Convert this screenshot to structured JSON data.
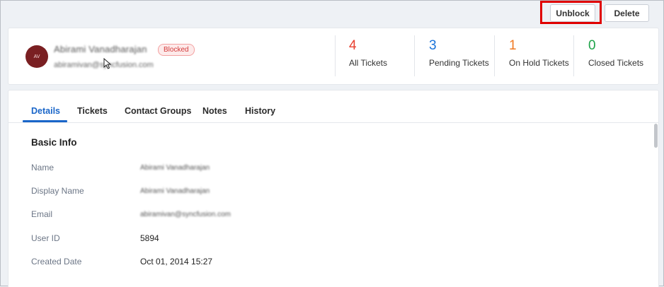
{
  "actions": {
    "unblock_label": "Unblock",
    "delete_label": "Delete"
  },
  "profile": {
    "initials": "AV",
    "name": "Abirami Vanadharajan",
    "email": "abiramivan@syncfusion.com",
    "status_badge": "Blocked"
  },
  "stats": [
    {
      "count": "4",
      "label": "All Tickets",
      "color": "#e8402f"
    },
    {
      "count": "3",
      "label": "Pending Tickets",
      "color": "#1a73d9"
    },
    {
      "count": "1",
      "label": "On Hold Tickets",
      "color": "#f07a22"
    },
    {
      "count": "0",
      "label": "Closed Tickets",
      "color": "#1fa34a"
    }
  ],
  "tabs": [
    {
      "label": "Details",
      "active": true
    },
    {
      "label": "Tickets"
    },
    {
      "label": "Contact Groups"
    },
    {
      "label": "Notes"
    },
    {
      "label": "History"
    }
  ],
  "basic_info": {
    "title": "Basic Info",
    "rows": [
      {
        "label": "Name",
        "value": "Abirami Vanadharajan"
      },
      {
        "label": "Display Name",
        "value": "Abirami Vanadharajan"
      },
      {
        "label": "Email",
        "value": "abiramivan@syncfusion.com"
      },
      {
        "label": "User ID",
        "value": "5894"
      },
      {
        "label": "Created Date",
        "value": "Oct 01, 2014 15:27"
      }
    ]
  },
  "colors": {
    "highlight": "#e00000",
    "accent": "#1a66c9",
    "blocked": "#d33b3b"
  }
}
